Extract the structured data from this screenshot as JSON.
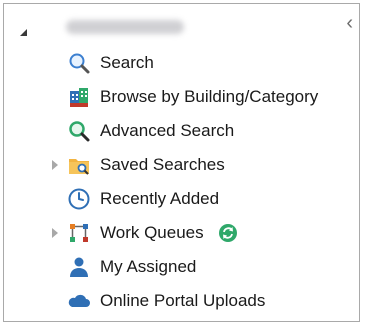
{
  "tree": {
    "items": [
      {
        "label": "Search",
        "icon": "search-icon"
      },
      {
        "label": "Browse by Building/Category",
        "icon": "building-icon"
      },
      {
        "label": "Advanced Search",
        "icon": "advanced-search-icon"
      },
      {
        "label": "Saved Searches",
        "icon": "folder-search-icon"
      },
      {
        "label": "Recently Added",
        "icon": "clock-icon"
      },
      {
        "label": "Work Queues",
        "icon": "workflow-icon"
      },
      {
        "label": "My Assigned",
        "icon": "user-icon"
      },
      {
        "label": "Online Portal Uploads",
        "icon": "cloud-upload-icon"
      }
    ]
  },
  "colors": {
    "accent_green": "#2fa86a",
    "icon_blue": "#2f6fb5",
    "icon_orange": "#e8a33a"
  }
}
